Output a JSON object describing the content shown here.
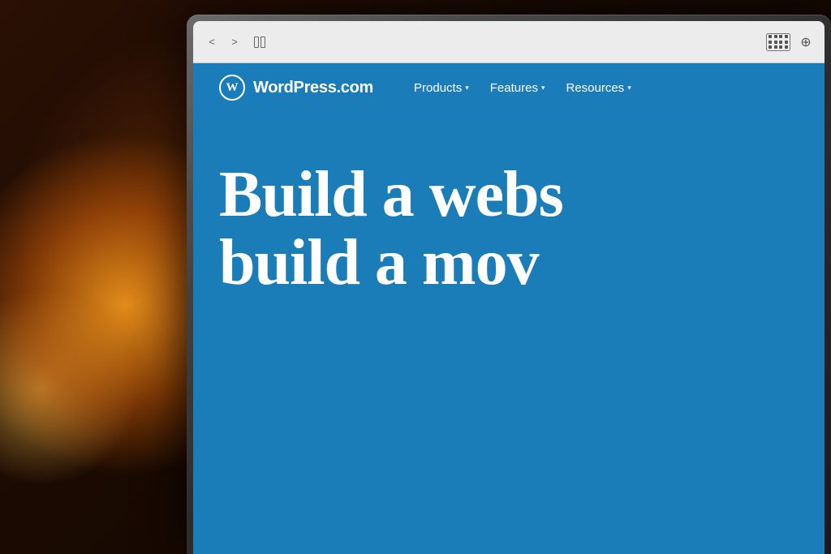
{
  "background": {
    "color": "#1a0a00"
  },
  "browser": {
    "nav_back_label": "<",
    "nav_forward_label": ">",
    "grid_icon": "grid-icon",
    "plus_icon": "plus-icon"
  },
  "website": {
    "logo_text": "W",
    "site_name": "WordPress.com",
    "nav": {
      "items": [
        {
          "label": "Products",
          "has_dropdown": true
        },
        {
          "label": "Features",
          "has_dropdown": true
        },
        {
          "label": "Resources",
          "has_dropdown": true
        }
      ]
    },
    "hero": {
      "line1": "Build a webs",
      "line2": "build a mov"
    }
  }
}
